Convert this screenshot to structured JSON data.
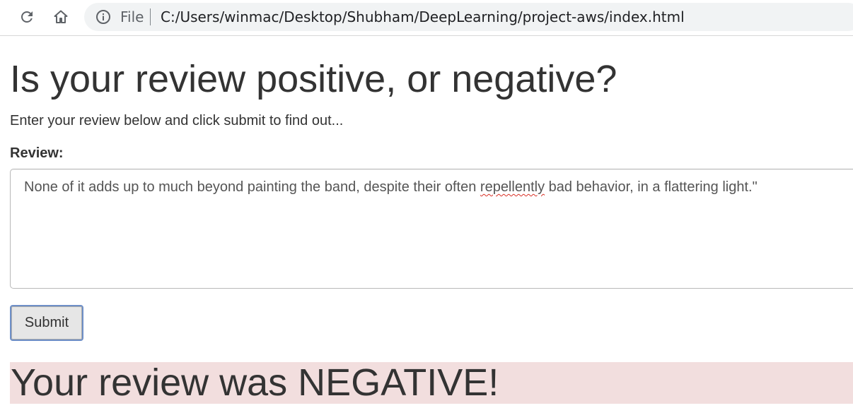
{
  "browser": {
    "scheme_label": "File",
    "url": "C:/Users/winmac/Desktop/Shubham/DeepLearning/project-aws/index.html",
    "icons": [
      "reload-icon",
      "home-icon",
      "info-icon"
    ]
  },
  "page": {
    "heading": "Is your review positive, or negative?",
    "lead": "Enter your review below and click submit to find out...",
    "review_label": "Review:",
    "review_text_before": "None of it adds up to much beyond painting the band, despite their often ",
    "review_text_flagged": "repellently",
    "review_text_after": " bad behavior, in a flattering light.\"",
    "submit_label": "Submit",
    "result": "Your review was NEGATIVE!"
  },
  "colors": {
    "result_background": "#f2dede",
    "button_border": "#6e8fc7",
    "spellcheck_underline": "#d93025"
  }
}
